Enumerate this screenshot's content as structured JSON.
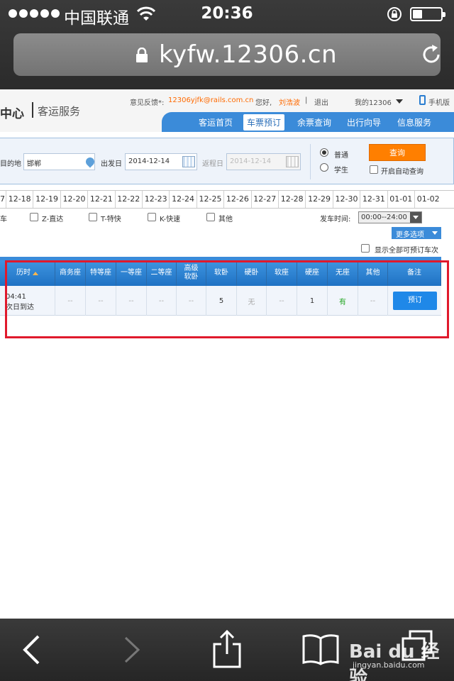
{
  "status_bar": {
    "carrier": "中国联通",
    "time": "20:36",
    "battery_level": 0.35
  },
  "url_bar": {
    "url": "kyfw.12306.cn"
  },
  "site": {
    "logo_text": "中心",
    "logo_sub": "客运服务",
    "feedback_label": "意见反馈*:",
    "feedback_email": "12306yjfk@rails.com.cn",
    "greeting": "您好,",
    "user_name": "刘浩波",
    "logout": "退出",
    "my_account": "我的12306",
    "mobile_version": "手机版",
    "nav": [
      "客运首页",
      "车票预订",
      "余票查询",
      "出行向导",
      "信息服务"
    ],
    "nav_active_index": 1
  },
  "search": {
    "to_label": "目的地",
    "to_value": "邯郸",
    "depart_label": "出发日",
    "depart_value": "2014-12-14",
    "return_label": "返程日",
    "return_value": "2014-12-14",
    "type_normal": "普通",
    "type_student": "学生",
    "query_button": "查询",
    "auto_query": "开启自动查询"
  },
  "dates": [
    "7",
    "12-18",
    "12-19",
    "12-20",
    "12-21",
    "12-22",
    "12-23",
    "12-24",
    "12-25",
    "12-26",
    "12-27",
    "12-28",
    "12-29",
    "12-30",
    "12-31",
    "01-01",
    "01-02"
  ],
  "filters": {
    "train_type_cut": "车",
    "types": [
      "Z-直达",
      "T-特快",
      "K-快速",
      "其他"
    ],
    "depart_time_label": "发车时间:",
    "depart_time_value": "00:00--24:00",
    "more_options": "更多选项",
    "show_all": "显示全部可预订车次"
  },
  "table": {
    "headers": [
      "历时",
      "商务座",
      "特等座",
      "一等座",
      "二等座",
      "高级\n软卧",
      "软卧",
      "硬卧",
      "软座",
      "硬座",
      "无座",
      "其他",
      "备注"
    ],
    "row": {
      "time": "04:41",
      "arrival": "次日到达",
      "cells": [
        "--",
        "--",
        "--",
        "--",
        "--",
        "5",
        "无",
        "--",
        "1",
        "有",
        "--"
      ],
      "book_button": "预订"
    }
  },
  "watermark": {
    "brand": "Bai du 经验",
    "sub": "jingyan.baidu.com"
  },
  "colors": {
    "accent_blue": "#3b8bd9",
    "query_orange": "#ff7f00",
    "highlight_red": "#e0192c",
    "available_green": "#22a622"
  }
}
